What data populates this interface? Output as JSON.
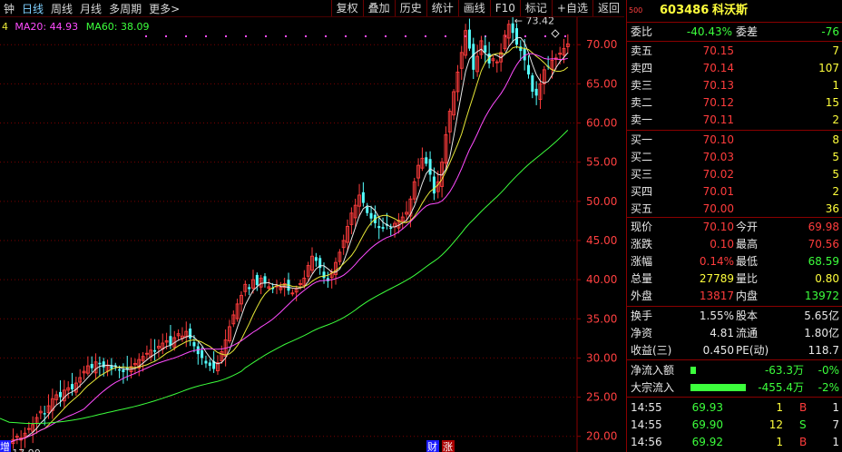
{
  "toolbar": {
    "left": [
      "钟",
      "日线",
      "周线",
      "月线",
      "多周期",
      "更多>"
    ],
    "active_index": 1,
    "right": [
      "复权",
      "叠加",
      "历史",
      "统计",
      "画线",
      "F10",
      "标记",
      "+自选",
      "返回"
    ]
  },
  "ma_labels": [
    {
      "text": "4",
      "color": "#e8e838"
    },
    {
      "text": "MA20: 44.93",
      "color": "#ff4cff"
    },
    {
      "text": "MA60: 38.09",
      "color": "#3cff3c"
    }
  ],
  "chart_data": {
    "type": "candlestick",
    "ylim": [
      18,
      73.5
    ],
    "yticks": [
      "20.00",
      "25.00",
      "30.00",
      "35.00",
      "40.00",
      "45.00",
      "50.00",
      "55.00",
      "60.00",
      "65.00",
      "70.00"
    ],
    "ytick_values": [
      20,
      25,
      30,
      35,
      40,
      45,
      50,
      55,
      60,
      65,
      70
    ],
    "high_annotation": "73.42",
    "low_annotation": "17.90",
    "bottom_marks": [
      "财",
      "涨"
    ],
    "bottom_left_mark": "增",
    "closes": [
      19.2,
      19.6,
      20.0,
      19.8,
      20.4,
      21.0,
      21.5,
      22.4,
      23.2,
      22.8,
      23.9,
      24.8,
      25.3,
      25.0,
      25.9,
      26.2,
      26.0,
      26.8,
      27.5,
      28.3,
      29.0,
      28.7,
      29.5,
      29.2,
      28.8,
      29.1,
      28.6,
      28.9,
      28.4,
      28.2,
      28.5,
      28.9,
      29.3,
      29.8,
      30.2,
      30.6,
      31.0,
      30.8,
      31.5,
      31.9,
      32.2,
      31.6,
      32.6,
      33.1,
      32.8,
      33.4,
      32.5,
      31.5,
      30.5,
      30.0,
      29.3,
      29.0,
      28.6,
      29.4,
      30.8,
      32.3,
      34.0,
      35.5,
      36.9,
      38.0,
      39.4,
      38.8,
      40.0,
      39.3,
      40.2,
      39.5,
      39.1,
      38.8,
      39.2,
      39.0,
      39.5,
      38.6,
      38.3,
      38.9,
      39.5,
      40.2,
      41.8,
      43.0,
      42.4,
      41.5,
      40.2,
      39.8,
      41.0,
      42.2,
      43.5,
      45.0,
      46.8,
      48.5,
      49.5,
      50.8,
      49.8,
      48.5,
      47.8,
      47.2,
      46.6,
      46.5,
      46.9,
      46.5,
      47.2,
      47.6,
      48.0,
      48.6,
      50.3,
      52.5,
      54.6,
      55.5,
      54.8,
      53.4,
      51.0,
      52.5,
      55.0,
      58.5,
      61.5,
      64.0,
      66.5,
      69.0,
      71.8,
      69.5,
      66.8,
      68.5,
      70.5,
      69.0,
      67.6,
      68.2,
      67.8,
      69.0,
      71.2,
      72.6,
      71.5,
      70.0,
      69.2,
      68.0,
      66.2,
      64.0,
      63.5,
      65.0,
      66.8,
      67.2,
      68.0,
      68.3,
      68.9,
      69.5,
      70.1
    ]
  },
  "panel": {
    "code": "603486",
    "name": "科沃斯",
    "webi_label": "委比",
    "webi_value": "-40.43%",
    "weicha_label": "委差",
    "weicha_value": "-76",
    "sells": [
      {
        "label": "卖五",
        "price": "70.15",
        "vol": "7"
      },
      {
        "label": "卖四",
        "price": "70.14",
        "vol": "107"
      },
      {
        "label": "卖三",
        "price": "70.13",
        "vol": "1"
      },
      {
        "label": "卖二",
        "price": "70.12",
        "vol": "15"
      },
      {
        "label": "卖一",
        "price": "70.11",
        "vol": "2"
      }
    ],
    "buys": [
      {
        "label": "买一",
        "price": "70.10",
        "vol": "8"
      },
      {
        "label": "买二",
        "price": "70.03",
        "vol": "5"
      },
      {
        "label": "买三",
        "price": "70.02",
        "vol": "5"
      },
      {
        "label": "买四",
        "price": "70.01",
        "vol": "2"
      },
      {
        "label": "买五",
        "price": "70.00",
        "vol": "36"
      }
    ],
    "stats": [
      {
        "l1": "现价",
        "v1": "70.10",
        "c1": "red",
        "l2": "今开",
        "v2": "69.98",
        "c2": "red"
      },
      {
        "l1": "涨跌",
        "v1": "0.10",
        "c1": "red",
        "l2": "最高",
        "v2": "70.56",
        "c2": "red"
      },
      {
        "l1": "涨幅",
        "v1": "0.14%",
        "c1": "red",
        "l2": "最低",
        "v2": "68.59",
        "c2": "green"
      },
      {
        "l1": "总量",
        "v1": "27789",
        "c1": "yellow",
        "l2": "量比",
        "v2": "0.80",
        "c2": "yellow"
      },
      {
        "l1": "外盘",
        "v1": "13817",
        "c1": "red",
        "l2": "内盘",
        "v2": "13972",
        "c2": "green"
      }
    ],
    "fund": [
      {
        "l1": "换手",
        "v1": "1.55%",
        "l2": "股本",
        "v2": "5.65亿"
      },
      {
        "l1": "净资",
        "v1": "4.81",
        "l2": "流通",
        "v2": "1.80亿"
      },
      {
        "l1": "收益(三)",
        "v1": "0.450",
        "l2": "PE(动)",
        "v2": "118.7"
      }
    ],
    "flow": [
      {
        "label": "净流入额",
        "amount": "-63.3万",
        "pct": "-0%",
        "bar": 0.03
      },
      {
        "label": "大宗流入",
        "amount": "-455.4万",
        "pct": "-2%",
        "bar": 0.95
      }
    ],
    "trades": [
      {
        "time": "14:55",
        "price": "69.93",
        "vol": "1",
        "side": "B",
        "num": "1"
      },
      {
        "time": "14:55",
        "price": "69.90",
        "vol": "12",
        "side": "S",
        "num": "7"
      },
      {
        "time": "14:56",
        "price": "69.92",
        "vol": "1",
        "side": "B",
        "num": "1"
      }
    ],
    "corner": "500"
  }
}
